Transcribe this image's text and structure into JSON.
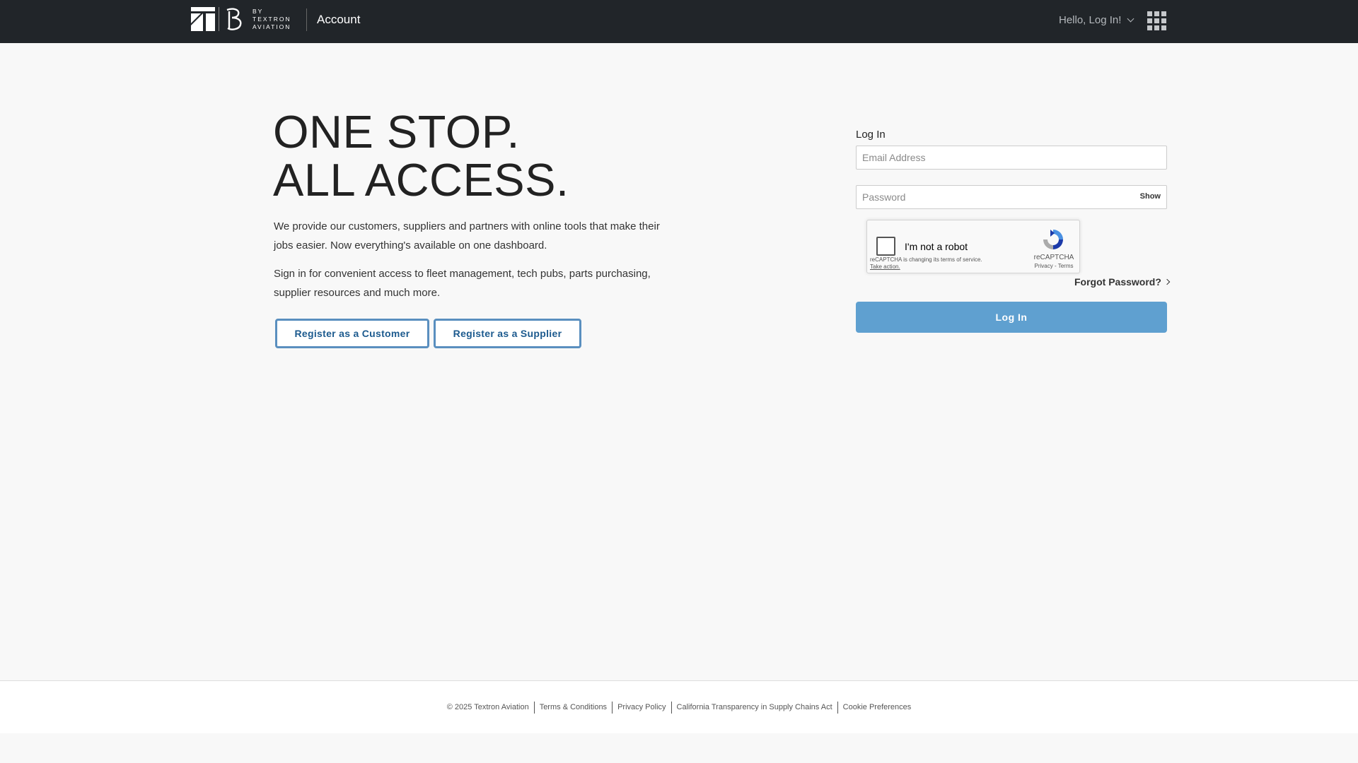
{
  "header": {
    "logo_text": [
      "BY",
      "TEXTRON",
      "AVIATION"
    ],
    "title": "Account",
    "user_menu_label": "Hello, Log In!"
  },
  "hero": {
    "title_line1": "ONE STOP.",
    "title_line2": "ALL ACCESS.",
    "paragraph1": "We provide our customers, suppliers and partners with online tools that make their jobs easier. Now everything's available on one dashboard.",
    "paragraph2": "Sign in for convenient access to fleet management, tech pubs, parts purchasing, supplier resources and much more.",
    "register_customer_label": "Register as a Customer",
    "register_supplier_label": "Register as a Supplier"
  },
  "login": {
    "heading": "Log In",
    "email_placeholder": "Email Address",
    "password_placeholder": "Password",
    "show_label": "Show",
    "recaptcha_label": "I'm not a robot",
    "recaptcha_notice": "reCAPTCHA is changing its terms of service.",
    "recaptcha_action": "Take action.",
    "recaptcha_brand": "reCAPTCHA",
    "recaptcha_links": "Privacy - Terms",
    "forgot_label": "Forgot Password?",
    "submit_label": "Log In",
    "submit_color": "#5fa0d0"
  },
  "footer": {
    "copyright": "© 2025 Textron Aviation",
    "links": [
      "Terms & Conditions",
      "Privacy Policy",
      "California Transparency in Supply Chains Act",
      "Cookie Preferences"
    ]
  },
  "icons": {
    "logo_mark": "textron-aviation-logo-icon",
    "user_chevron": "chevron-down-icon",
    "apps": "apps-grid-icon",
    "recaptcha": "recaptcha-logo-icon",
    "forgot": "chevron-right-icon"
  }
}
